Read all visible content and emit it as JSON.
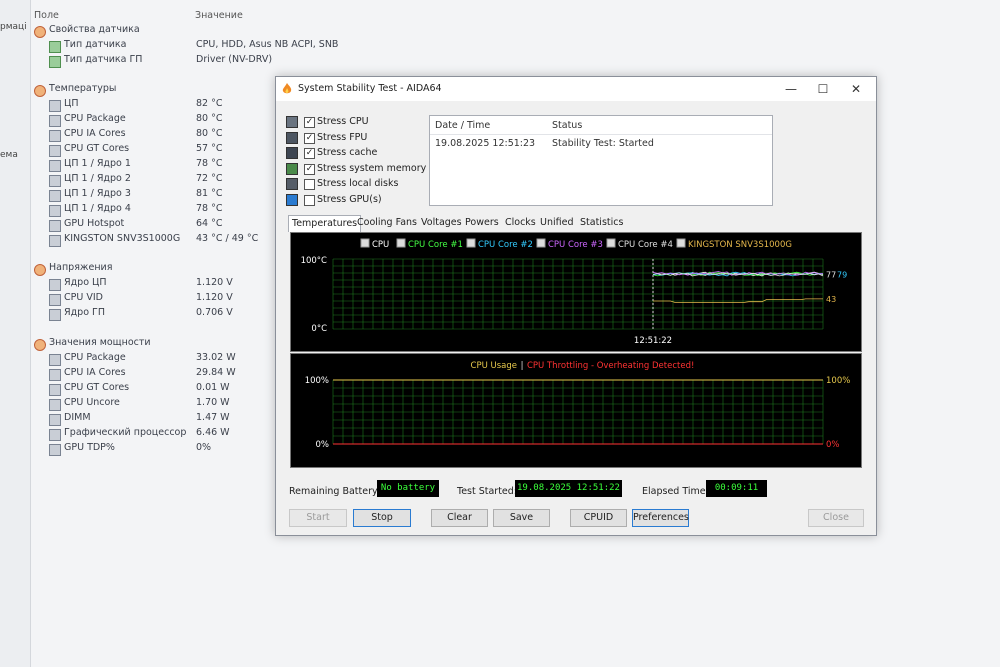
{
  "left_strip": [
    "рмаці",
    "ема"
  ],
  "sensor_panel": {
    "col_field": "Поле",
    "col_value": "Значение",
    "groups": [
      {
        "title": "Свойства датчика",
        "rows": [
          {
            "label": "Тип датчика",
            "value": "CPU, HDD, Asus NB ACPI, SNB"
          },
          {
            "label": "Тип датчика ГП",
            "value": "Driver  (NV-DRV)"
          }
        ]
      },
      {
        "title": "Температуры",
        "rows": [
          {
            "label": "ЦП",
            "value": "82 °C"
          },
          {
            "label": "CPU Package",
            "value": "80 °C"
          },
          {
            "label": "CPU IA Cores",
            "value": "80 °C"
          },
          {
            "label": "CPU GT Cores",
            "value": "57 °C"
          },
          {
            "label": "ЦП 1 / Ядро 1",
            "value": "78 °C"
          },
          {
            "label": "ЦП 1 / Ядро 2",
            "value": "72 °C"
          },
          {
            "label": "ЦП 1 / Ядро 3",
            "value": "81 °C"
          },
          {
            "label": "ЦП 1 / Ядро 4",
            "value": "78 °C"
          },
          {
            "label": "GPU Hotspot",
            "value": "64 °C"
          },
          {
            "label": "KINGSTON SNV3S1000G",
            "value": "43 °C / 49 °C"
          }
        ]
      },
      {
        "title": "Напряжения",
        "rows": [
          {
            "label": "Ядро ЦП",
            "value": "1.120 V"
          },
          {
            "label": "CPU VID",
            "value": "1.120 V"
          },
          {
            "label": "Ядро ГП",
            "value": "0.706 V"
          }
        ]
      },
      {
        "title": "Значения мощности",
        "rows": [
          {
            "label": "CPU Package",
            "value": "33.02 W"
          },
          {
            "label": "CPU IA Cores",
            "value": "29.84 W"
          },
          {
            "label": "CPU GT Cores",
            "value": "0.01 W"
          },
          {
            "label": "CPU Uncore",
            "value": "1.70 W"
          },
          {
            "label": "DIMM",
            "value": "1.47 W"
          },
          {
            "label": "Графический процессор",
            "value": "6.46 W"
          },
          {
            "label": "GPU TDP%",
            "value": "0%"
          }
        ]
      }
    ]
  },
  "window": {
    "title": "System Stability Test - AIDA64",
    "controls": {
      "minimize": "—",
      "maximize": "☐",
      "close": "✕"
    },
    "stress_options": [
      {
        "label": "Stress CPU",
        "checked": true
      },
      {
        "label": "Stress FPU",
        "checked": true
      },
      {
        "label": "Stress cache",
        "checked": true
      },
      {
        "label": "Stress system memory",
        "checked": true
      },
      {
        "label": "Stress local disks",
        "checked": false
      },
      {
        "label": "Stress GPU(s)",
        "checked": false
      }
    ],
    "status_table": {
      "headers": [
        "Date / Time",
        "Status"
      ],
      "rows": [
        [
          "19.08.2025 12:51:23",
          "Stability Test: Started"
        ]
      ]
    },
    "tabs": [
      "Temperatures",
      "Cooling Fans",
      "Voltages",
      "Powers",
      "Clocks",
      "Unified",
      "Statistics"
    ],
    "active_tab": "Temperatures",
    "temp_chart": {
      "legend": [
        {
          "name": "CPU",
          "color": "#ffffff"
        },
        {
          "name": "CPU Core #1",
          "color": "#44ff44"
        },
        {
          "name": "CPU Core #2",
          "color": "#33ccff"
        },
        {
          "name": "CPU Core #3",
          "color": "#cc66ff"
        },
        {
          "name": "CPU Core #4",
          "color": "#e0e0e0"
        },
        {
          "name": "KINGSTON SNV3S1000G",
          "color": "#e6b84c"
        }
      ],
      "y_top": "100°C",
      "y_bottom": "0°C",
      "x_marker": "12:51:22",
      "right_value_high": "77",
      "right_value_high2": "79",
      "right_value_low": "43",
      "grid_color": "#1e7a1e"
    },
    "usage_chart": {
      "title_usage": "CPU Usage",
      "separator": "|",
      "title_throttle": "CPU Throttling - Overheating Detected!",
      "y_top_left": "100%",
      "y_bottom_left": "0%",
      "y_top_right": "100%",
      "y_bottom_right": "0%",
      "usage_color": "#e6c84c",
      "throttle_color": "#ff3333"
    },
    "footer": {
      "battery_label": "Remaining Battery:",
      "battery_value": "No battery",
      "started_label": "Test Started:",
      "started_value": "19.08.2025 12:51:22",
      "elapsed_label": "Elapsed Time:",
      "elapsed_value": "00:09:11"
    },
    "buttons": {
      "start": "Start",
      "stop": "Stop",
      "clear": "Clear",
      "save": "Save",
      "cpuid": "CPUID",
      "preferences": "Preferences",
      "close": "Close"
    }
  },
  "chart_data": [
    {
      "type": "line",
      "title": "",
      "ylim": [
        0,
        100
      ],
      "x_marker": "12:51:22",
      "series": [
        {
          "name": "CPU",
          "values": [
            79,
            78,
            80,
            78,
            79,
            77,
            79,
            78,
            80,
            77
          ]
        },
        {
          "name": "CPU Core #1",
          "values": [
            77,
            79,
            78,
            80,
            78,
            77,
            79,
            80,
            78,
            79
          ]
        },
        {
          "name": "CPU Core #2",
          "values": [
            78,
            80,
            79,
            77,
            80,
            79,
            78,
            77,
            79,
            78
          ]
        },
        {
          "name": "CPU Core #3",
          "values": [
            80,
            78,
            79,
            81,
            78,
            80,
            79,
            78,
            80,
            79
          ]
        },
        {
          "name": "CPU Core #4",
          "values": [
            78,
            79,
            77,
            79,
            78,
            79,
            77,
            79,
            78,
            77
          ]
        },
        {
          "name": "KINGSTON SNV3S1000G",
          "values": [
            40,
            38,
            38,
            38,
            38,
            39,
            42,
            42,
            43,
            43
          ]
        }
      ]
    },
    {
      "type": "line",
      "title": "",
      "ylim": [
        0,
        100
      ],
      "series": [
        {
          "name": "CPU Usage",
          "values": [
            100,
            100,
            100,
            100,
            100,
            100,
            100,
            100,
            100,
            100
          ]
        },
        {
          "name": "CPU Throttling - Overheating Detected!",
          "values": [
            0,
            0,
            0,
            0,
            0,
            0,
            0,
            0,
            0,
            0
          ]
        }
      ]
    }
  ]
}
